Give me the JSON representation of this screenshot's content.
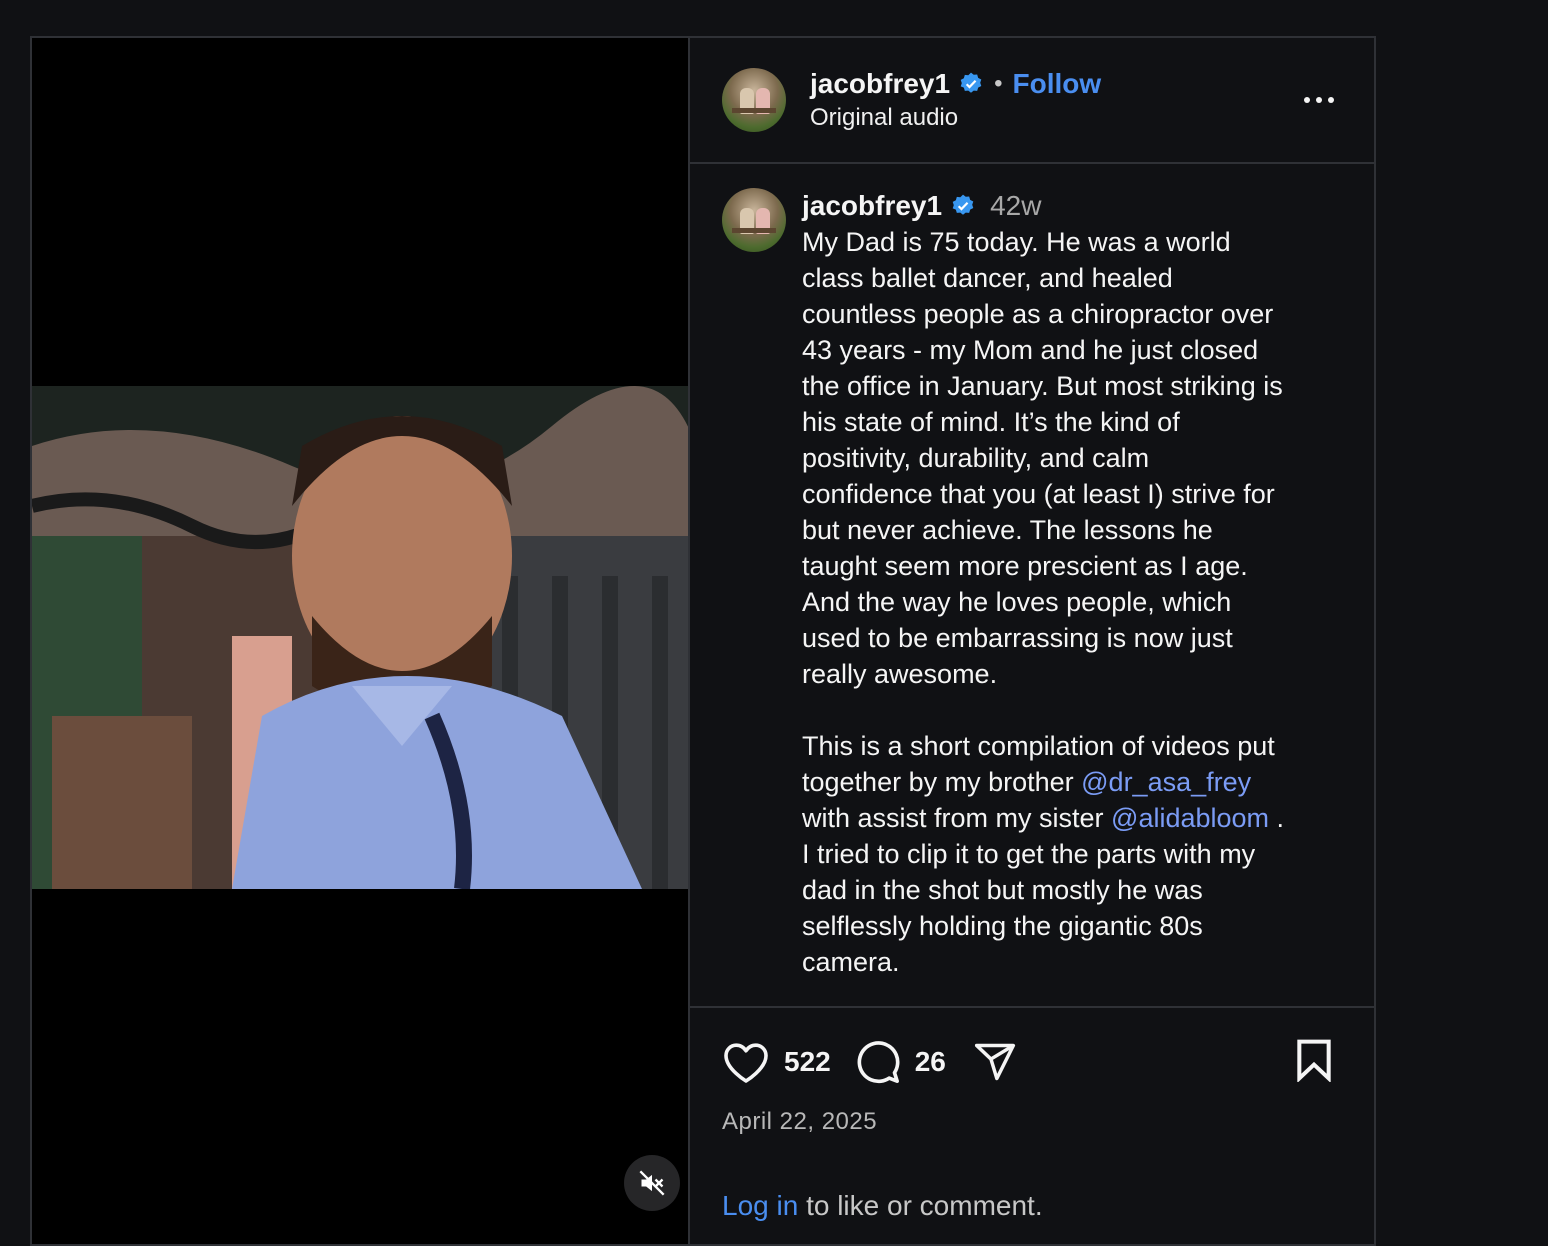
{
  "header": {
    "username": "jacobfrey1",
    "separator": "•",
    "follow_label": "Follow",
    "audio_label": "Original audio"
  },
  "caption": {
    "username": "jacobfrey1",
    "time_ago": "42w",
    "paragraph1": "My Dad is 75 today. He was a world\nclass ballet dancer, and healed\ncountless people as a chiropractor over\n43 years - my Mom and he just closed\nthe office in January. But most striking is\nhis state of mind. It’s the kind of\npositivity, durability, and calm\nconfidence that you (at least I) strive for\nbut never achieve. The lessons he\ntaught seem more prescient as I age.\nAnd the way he loves people, which\nused to be embarrassing is now just\nreally awesome.",
    "p2_part1": "This is a short compilation of videos put\ntogether by my brother ",
    "mention1": "@dr_asa_frey",
    "p2_part2": "\nwith assist from my sister ",
    "mention2": "@alidabloom",
    "p2_part3": " .\nI tried to clip it to get the parts with my\ndad in the shot but mostly he was\nselflessly holding the gigantic 80s\ncamera."
  },
  "actions": {
    "likes": "522",
    "comments": "26",
    "date": "April 22, 2025"
  },
  "footer": {
    "login_link": "Log in",
    "login_rest": " to like or comment."
  },
  "icons": {
    "verified": "verified-badge-icon",
    "more": "more-options-icon",
    "like": "heart-icon",
    "comment": "comment-bubble-icon",
    "share": "share-paper-plane-icon",
    "save": "bookmark-icon",
    "mute": "speaker-muted-icon"
  },
  "colors": {
    "background": "#101114",
    "border": "#2f3136",
    "link_blue": "#4a8ef0",
    "mention_blue": "#7b9cf5",
    "verified_blue": "#3897f0"
  }
}
